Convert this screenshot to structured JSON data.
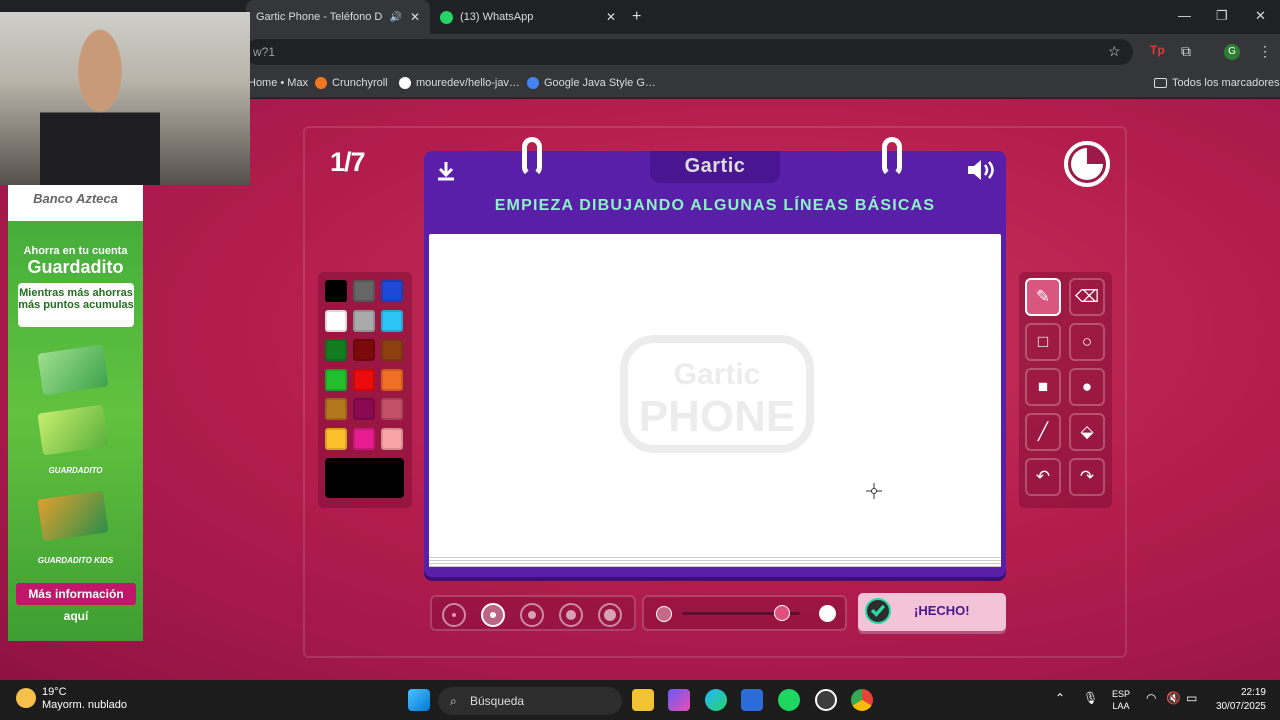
{
  "browser": {
    "tabs": [
      {
        "title": "Gartic Phone - Teléfono De…",
        "active": true
      },
      {
        "title": "(13) WhatsApp",
        "active": false
      }
    ],
    "new_tab_label": "+",
    "url": "w?1",
    "bookmarks": [
      {
        "label": "Home • Max",
        "color": "#e05030"
      },
      {
        "label": "Crunchyroll",
        "color": "#f47521"
      },
      {
        "label": "mouredev/hello-jav…",
        "color": "#ffffff"
      },
      {
        "label": "Google Java Style G…",
        "color": "#4285f4"
      }
    ],
    "all_bookmarks": "Todos los marcadores",
    "window_controls": {
      "minimize": "—",
      "restore": "❐",
      "close": "✕"
    }
  },
  "game": {
    "round": "1/7",
    "logo": "Gartic",
    "prompt": "EMPIEZA DIBUJANDO ALGUNAS LÍNEAS BÁSICAS",
    "watermark_line1": "Gartic",
    "watermark_line2": "PHONE",
    "done_label": "¡HECHO!",
    "palette": [
      "#000000",
      "#666666",
      "#1e49d6",
      "#ffffff",
      "#aaaaaa",
      "#2cc5f5",
      "#127d1e",
      "#7b0a0a",
      "#8e3f10",
      "#21c02c",
      "#ec0b0b",
      "#ef6f24",
      "#b4771d",
      "#8a0a52",
      "#c45168",
      "#fcc02a",
      "#e71c90",
      "#f9a5a8"
    ],
    "current_color": "#000000",
    "tools": [
      "pencil-icon",
      "eraser-icon",
      "rect-outline-icon",
      "circle-outline-icon",
      "rect-fill-icon",
      "circle-fill-icon",
      "line-icon",
      "bucket-icon",
      "undo-icon",
      "redo-icon"
    ],
    "selected_tool": "pencil-icon",
    "brush_sizes": [
      1,
      2,
      3,
      4,
      5
    ],
    "selected_brush_size": 2,
    "opacity": 0.85
  },
  "ad": {
    "brand": "Banco Azteca",
    "line1": "Ahorra en tu cuenta",
    "line2": "Guardadito",
    "box": "Mientras más ahorras más puntos acumulas",
    "label1": "GUARDADITO",
    "label2": "GUARDADITO KIDS",
    "button": "Más información aquí"
  },
  "taskbar": {
    "temp": "19°C",
    "weather": "Mayorm. nublado",
    "search": "Búsqueda",
    "lang1": "ESP",
    "lang2": "LAA",
    "time": "22:19",
    "date": "30/07/2025"
  }
}
